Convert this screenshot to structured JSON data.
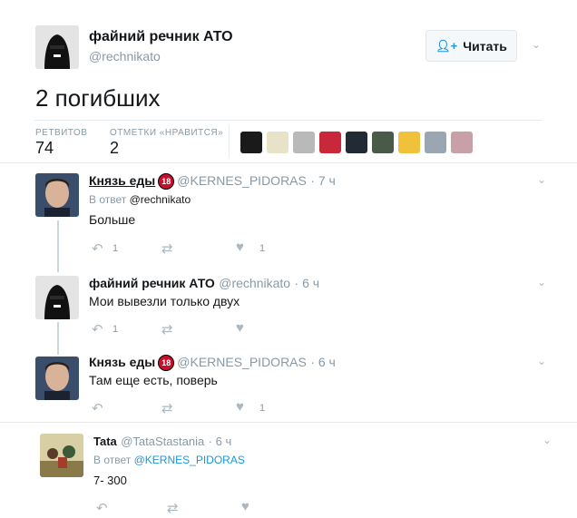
{
  "main_tweet": {
    "name": "файний речник АТО",
    "handle": "@rechnikato",
    "follow_label": "Читать",
    "text": "2 погибших",
    "stats": {
      "retweets_label": "РЕТВИТОВ",
      "retweets_value": "74",
      "likes_label": "ОТМЕТКИ «НРАВИТСЯ»",
      "likes_value": "2"
    }
  },
  "replies": [
    {
      "name": "Князь еды",
      "badge": "18",
      "handle": "@KERNES_PIDORAS",
      "time": "· 7 ч",
      "reply_prefix": "В ответ",
      "reply_to": "@rechnikato",
      "text": "Больше",
      "reply_count": "1",
      "retweet_count": "",
      "like_count": "1"
    },
    {
      "name": "файний речник АТО",
      "handle": "@rechnikato",
      "time": "· 6 ч",
      "text": "Мои вывезли только двух",
      "reply_count": "1",
      "retweet_count": "",
      "like_count": ""
    },
    {
      "name": "Князь еды",
      "badge": "18",
      "handle": "@KERNES_PIDORAS",
      "time": "· 6 ч",
      "text": "Там еще есть, поверь",
      "reply_count": "",
      "retweet_count": "",
      "like_count": "1"
    },
    {
      "name": "Tata",
      "handle": "@TataStastania",
      "time": "· 6 ч",
      "reply_prefix": "В ответ",
      "reply_to": "@KERNES_PIDORAS",
      "text": "7- 300",
      "reply_count": "",
      "retweet_count": "",
      "like_count": ""
    }
  ],
  "icons": {
    "reply": "reply-icon",
    "retweet": "retweet-icon",
    "like": "heart-icon",
    "chevron": "chevron-down-icon",
    "follow": "add-user-icon"
  },
  "colors": {
    "accent": "#1b95e0",
    "muted": "#8899a6",
    "badge": "#c8102e"
  }
}
